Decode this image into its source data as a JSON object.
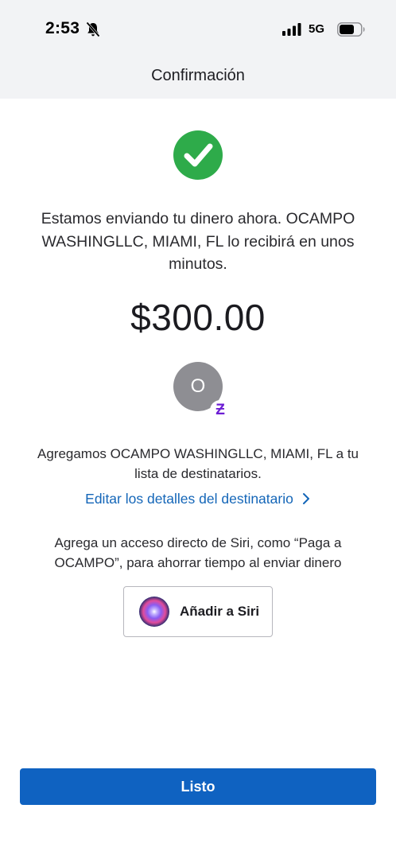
{
  "status_bar": {
    "time": "2:53",
    "network": "5G",
    "icons": [
      "bell-slash-icon",
      "cellular-signal-icon",
      "battery-icon"
    ]
  },
  "header": {
    "title": "Confirmación"
  },
  "confirmation": {
    "icon": "checkmark-circle-icon",
    "success_color": "#2eab4a",
    "message": "Estamos enviando tu dinero ahora. OCAMPO WASHINGLLC, MIAMI, FL lo recibirá en unos minutos.",
    "amount": "$300.00"
  },
  "recipient": {
    "avatar_letter": "O",
    "badge_glyph": "Ƶ",
    "badge_color": "#6d1ed4",
    "added_note": "Agregamos OCAMPO WASHINGLLC, MIAMI, FL a tu lista de destinatarios.",
    "edit_link": "Editar los detalles del destinatario",
    "link_color": "#1466b8"
  },
  "siri": {
    "note": "Agrega un acceso directo de Siri, como “Paga a OCAMPO”, para ahorrar tiempo al enviar dinero",
    "button_label": "Añadir a Siri",
    "icon": "siri-icon"
  },
  "footer": {
    "done_label": "Listo",
    "button_color": "#0f62c1"
  }
}
